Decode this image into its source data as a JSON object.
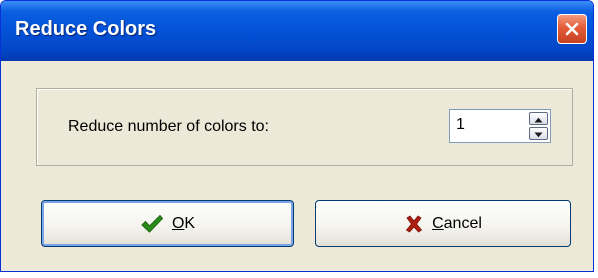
{
  "window": {
    "title": "Reduce Colors",
    "close_icon": "close-icon",
    "accent_color": "#0450d6",
    "close_color": "#e35d3b"
  },
  "form": {
    "label": "Reduce number of colors to:",
    "value": "1",
    "stepper_icons": [
      "chevron-up-icon",
      "chevron-down-icon"
    ]
  },
  "buttons": {
    "ok": {
      "mnemonic": "O",
      "rest": "K",
      "icon": "checkmark-icon",
      "icon_color": "#2a8c1a"
    },
    "cancel": {
      "mnemonic": "C",
      "rest": "ancel",
      "icon": "x-icon",
      "icon_color": "#b01e10"
    }
  }
}
